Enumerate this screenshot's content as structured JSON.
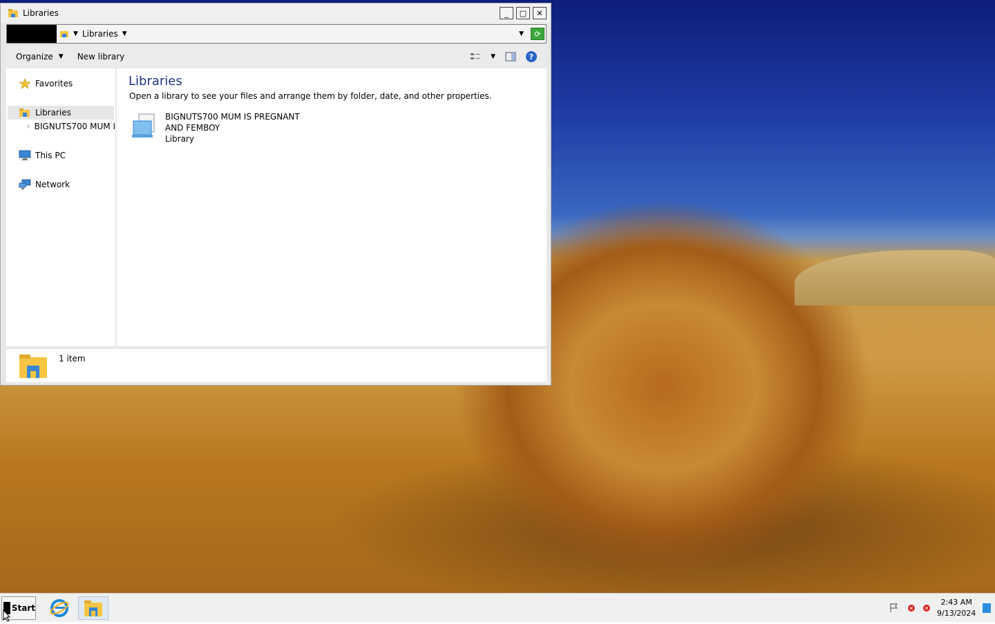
{
  "window": {
    "title": "Libraries",
    "minimize": "_",
    "maximize": "□",
    "close": "✕"
  },
  "address": {
    "path": "Libraries",
    "dropdown_arrow": "▼",
    "refresh_symbol": "⟳"
  },
  "toolbar": {
    "organize": "Organize",
    "organize_arrow": "▼",
    "new_library": "New library",
    "view_arrow": "▼",
    "help": "?"
  },
  "nav": {
    "favorites": "Favorites",
    "libraries": "Libraries",
    "library_child": "BIGNUTS700 MUM I",
    "this_pc": "This PC",
    "network": "Network"
  },
  "content": {
    "title": "Libraries",
    "description": "Open a library to see your files and arrange them by folder, date, and other properties.",
    "item": {
      "name_line1": "BIGNUTS700 MUM IS PREGNANT",
      "name_line2": "AND FEMBOY",
      "type": "Library"
    }
  },
  "status": {
    "count": "1 item"
  },
  "taskbar": {
    "start": "Start",
    "time": "2:43 AM",
    "date": "9/13/2024"
  },
  "colors": {
    "accent": "#1e3287",
    "folder": "#f5c542",
    "pc": "#3a86d4"
  }
}
